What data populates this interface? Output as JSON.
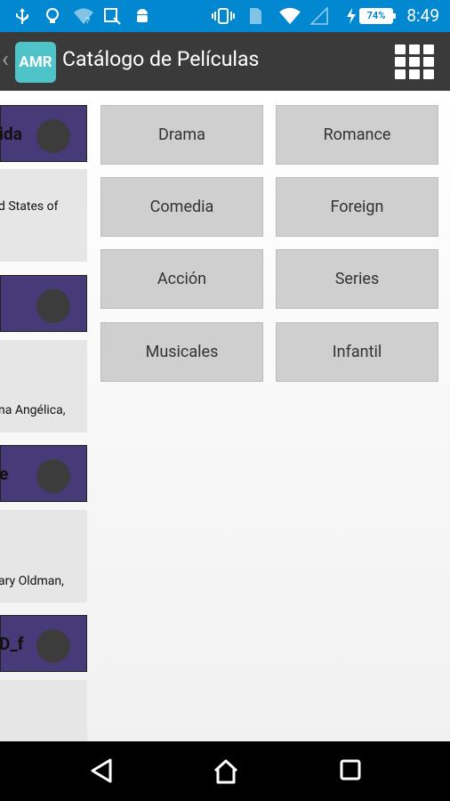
{
  "status_bar": {
    "time": "8:49",
    "battery_percent": "74%",
    "icons": [
      "usb-icon",
      "lightbulb-icon",
      "wifi-question-icon",
      "screenshot-icon",
      "android-icon",
      "vibrate-icon",
      "sim-icon",
      "wifi-icon",
      "signal-icon",
      "charging-icon",
      "battery-icon"
    ]
  },
  "action_bar": {
    "logo_text": "AMR",
    "title": "Catálogo de Películas",
    "menu_icon": "grid-menu-icon"
  },
  "left_list": {
    "items": [
      {
        "header_title": "ida",
        "body_text": "d States of"
      },
      {
        "header_title": "",
        "body_text": "na Angélica,"
      },
      {
        "header_title": "e",
        "body_text": "ary Oldman,"
      },
      {
        "header_title": "D_f",
        "body_text": ""
      }
    ]
  },
  "genres": [
    "Drama",
    "Romance",
    "Comedia",
    "Foreign",
    "Acción",
    "Series",
    "Musicales",
    "Infantil"
  ],
  "nav_bar": {
    "icons": [
      "back-icon",
      "home-icon",
      "recents-icon"
    ]
  },
  "colors": {
    "status_bar": "#0288d1",
    "action_bar": "#3a3a3a",
    "logo": "#4ec3c8",
    "movie_header": "#463a78",
    "genre_button": "#cfcfcf"
  }
}
